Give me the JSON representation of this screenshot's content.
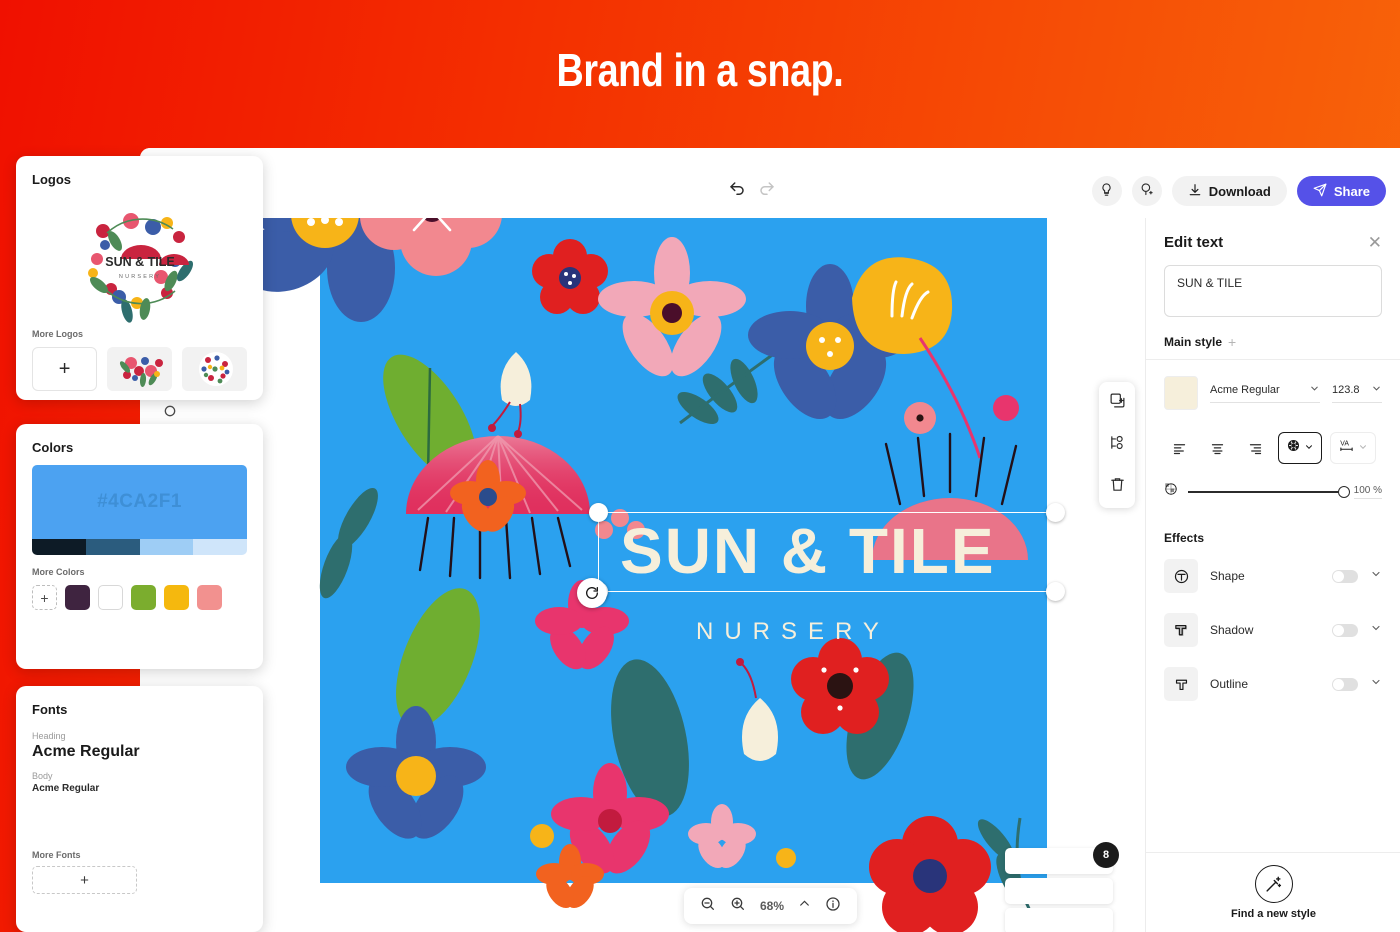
{
  "hero": {
    "title": "Brand in a snap."
  },
  "theme": {
    "hero_gradient_from": "#F01000",
    "hero_gradient_to": "#F86A0B",
    "share_button_color": "#5551E8",
    "artboard_bg": "#2BA1EF",
    "text_cream": "#F6EFDB"
  },
  "topbar": {
    "undo_icon": "undo-arrow-icon",
    "redo_icon": "redo-arrow-icon",
    "idea_icon": "lightbulb-icon",
    "invite_icon": "add-person-icon",
    "download_label": "Download",
    "download_icon": "download-icon",
    "share_label": "Share",
    "share_icon": "paper-plane-icon"
  },
  "canvas": {
    "brand_title": "SUN & TILE",
    "brand_subtitle": "NURSERY",
    "object_toolbar": [
      {
        "name": "duplicate-icon"
      },
      {
        "name": "arrange-icon"
      },
      {
        "name": "delete-icon"
      }
    ],
    "badge_count": "8",
    "zoombar": {
      "zoom_out_icon": "zoom-out-icon",
      "zoom_in_icon": "zoom-in-icon",
      "zoom_level": "68%",
      "expand_icon": "chevron-up-icon",
      "info_icon": "info-icon"
    }
  },
  "right_panel": {
    "title": "Edit text",
    "close_icon": "close-icon",
    "text_value": "SUN & TILE",
    "main_style_label": "Main style",
    "main_style_add": "+",
    "color_swatch": "#F6EFDB",
    "font_family": "Acme Regular",
    "font_size": "123.8",
    "align_icons": [
      "align-left-icon",
      "align-center-icon",
      "align-right-icon"
    ],
    "texture_icon": "texture-icon",
    "letter_spacing_icon": "letter-spacing-icon",
    "opacity_icon": "opacity-icon",
    "opacity_value": "100 %",
    "effects_title": "Effects",
    "effects": [
      {
        "label": "Shape",
        "icon": "shape-effect-icon",
        "enabled": false
      },
      {
        "label": "Shadow",
        "icon": "shadow-effect-icon",
        "enabled": false
      },
      {
        "label": "Outline",
        "icon": "outline-effect-icon",
        "enabled": false
      }
    ],
    "find_style_label": "Find a new style",
    "find_style_icon": "magic-wand-icon"
  },
  "panels": {
    "logos": {
      "title": "Logos",
      "more_label": "More Logos",
      "add_icon": "plus-icon",
      "logo_text": "SUN & TILE",
      "logo_subtext": "NURSERY"
    },
    "colors": {
      "title": "Colors",
      "main_hex": "#4CA2F1",
      "tints": [
        "#0D1B26",
        "#2B5C7E",
        "#9ECDF5",
        "#CFE5FA"
      ],
      "more_label": "More Colors",
      "add_icon": "plus-icon",
      "chips": [
        "#3F2440",
        "#FFFFFF",
        "#7BAD2E",
        "#F5B80E",
        "#F2918F"
      ]
    },
    "fonts": {
      "title": "Fonts",
      "heading_label": "Heading",
      "heading_font": "Acme Regular",
      "body_label": "Body",
      "body_font": "Acme Regular",
      "more_label": "More Fonts",
      "add_icon": "plus-icon"
    }
  }
}
